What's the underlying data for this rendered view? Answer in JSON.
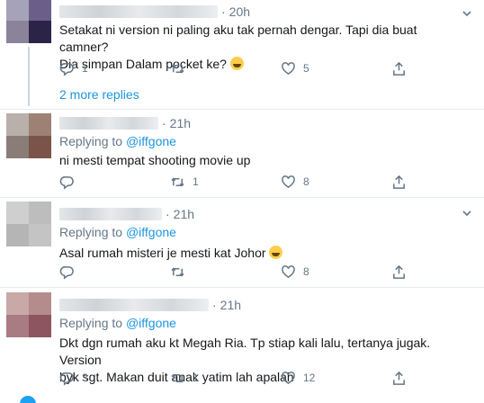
{
  "tweets": [
    {
      "time": "20h",
      "replying_label": "",
      "replying_handle": "",
      "text_line1": "Setakat ni version ni paling aku tak pernah dengar. Tapi dia buat camner?",
      "text_line2": "Dia simpan Dalam pocket ke?",
      "replies": "1",
      "retweets": "",
      "likes": "5"
    },
    {
      "time": "21h",
      "replying_label": "Replying to",
      "replying_handle": "@iffgone",
      "text_line1": "ni mesti tempat shooting movie up",
      "text_line2": "",
      "replies": "",
      "retweets": "1",
      "likes": "8"
    },
    {
      "time": "21h",
      "replying_label": "Replying to",
      "replying_handle": "@iffgone",
      "text_line1": "Asal rumah misteri je mesti kat Johor",
      "text_line2": "",
      "replies": "",
      "retweets": "",
      "likes": "8"
    },
    {
      "time": "21h",
      "replying_label": "Replying to",
      "replying_handle": "@iffgone",
      "text_line1": "Dkt dgn rumah aku kt Megah Ria. Tp stiap kali lalu, tertanya jugak. Version",
      "text_line2": "byk sgt. Makan duit anak yatim lah apalah",
      "replies": "3",
      "retweets": "1",
      "likes": "12"
    }
  ],
  "more_replies": "2 more replies",
  "icons": {
    "reply": "reply-icon",
    "retweet": "retweet-icon",
    "like": "heart-icon",
    "share": "share-icon",
    "caret": "chevron-down-icon"
  },
  "colors": {
    "link": "#1b95e0",
    "muted": "#657786",
    "divider": "#e6ecf0"
  }
}
